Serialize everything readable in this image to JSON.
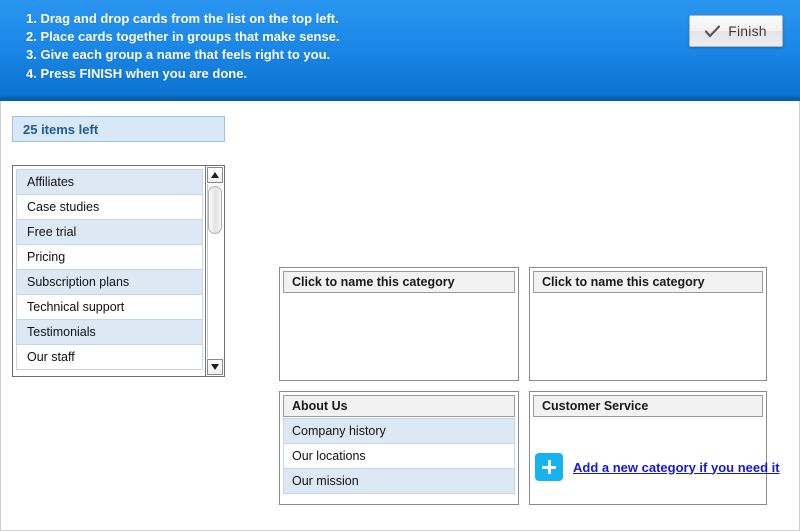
{
  "header": {
    "instructions": [
      "1. Drag and drop cards from the list on the top left.",
      "2. Place cards together in groups that make sense.",
      "3. Give each group a name that feels right to you.",
      "4. Press FINISH when you are done."
    ],
    "finish_label": "Finish",
    "finish_icon": "check-icon",
    "background_color": "#1c88e8"
  },
  "status": {
    "items_left_label": "25 items left",
    "items_left_count": 25,
    "badge_color": "#d8e8f6",
    "badge_text_color": "#1d5c96"
  },
  "card_list": {
    "items": [
      "Affiliates",
      "Case studies",
      "Free trial",
      "Pricing",
      "Subscription plans",
      "Technical support",
      "Testimonials",
      "Our staff"
    ],
    "scrollbar": {
      "up_icon": "triangle-up-icon",
      "down_icon": "triangle-down-icon"
    }
  },
  "categories": [
    {
      "title": "Click to name this category",
      "named": false,
      "cards": []
    },
    {
      "title": "Click to name this category",
      "named": false,
      "cards": []
    },
    {
      "title": "About Us",
      "named": true,
      "cards": [
        "Company history",
        "Our locations",
        "Our mission"
      ]
    },
    {
      "title": "Customer Service",
      "named": true,
      "cards": []
    }
  ],
  "add_category": {
    "icon": "plus-icon",
    "link_label": "Add a new category if you need it",
    "link_color": "#1515e0",
    "button_color": "#17b2f0"
  }
}
